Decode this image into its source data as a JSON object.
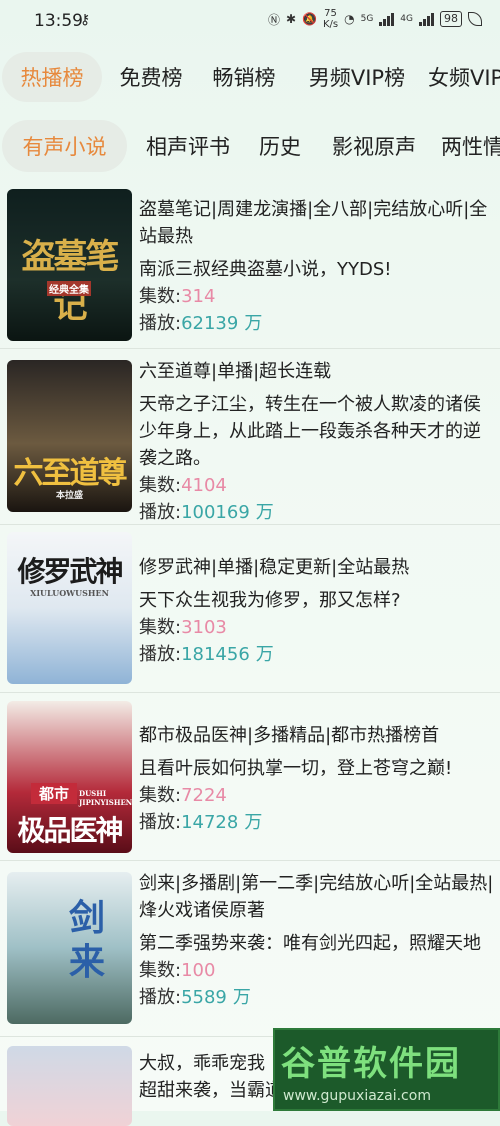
{
  "status": {
    "time": "13:59",
    "speed_value": "75",
    "speed_unit": "K/s",
    "battery": "98",
    "net1": "5G",
    "net2": "4G"
  },
  "top_tabs": [
    {
      "label": "热播榜",
      "active": true
    },
    {
      "label": "免费榜",
      "active": false
    },
    {
      "label": "畅销榜",
      "active": false
    },
    {
      "label": "男频VIP榜",
      "active": false
    },
    {
      "label": "女频VIP",
      "active": false
    }
  ],
  "sub_tabs": [
    {
      "label": "有声小说",
      "active": true
    },
    {
      "label": "相声评书",
      "active": false
    },
    {
      "label": "历史",
      "active": false
    },
    {
      "label": "影视原声",
      "active": false
    },
    {
      "label": "两性情",
      "active": false
    }
  ],
  "labels": {
    "episodes": "集数:",
    "plays": "播放:",
    "wan": "万"
  },
  "books": [
    {
      "cover_title": "盗墓笔记",
      "cover_sub": "经典全集",
      "title": "盗墓笔记|周建龙演播|全八部|完结放心听|全站最热",
      "desc": "南派三叔经典盗墓小说，YYDS!",
      "episodes": "314",
      "plays": "62139"
    },
    {
      "cover_title": "六至道尊",
      "cover_sub": "本拉盛",
      "title": "六至道尊|单播|超长连载",
      "desc": "天帝之子江尘，转生在一个被人欺凌的诸侯少年身上，从此踏上一段轰杀各种天才的逆袭之路。",
      "episodes": "4104",
      "plays": "100169"
    },
    {
      "cover_title": "修罗武神",
      "cover_sub": "XIULUOWUSHEN",
      "title": "修罗武神|单播|稳定更新|全站最热",
      "desc": "天下众生视我为修罗，那又怎样?",
      "episodes": "3103",
      "plays": "181456"
    },
    {
      "cover_title": "极品医神",
      "cover_sub": "都市",
      "cover_pinyin": "DUSHI JIPINYISHEN",
      "title": "都市极品医神|多播精品|都市热播榜首",
      "desc": "且看叶辰如何执掌一切，登上苍穹之巅!",
      "episodes": "7224",
      "plays": "14728"
    },
    {
      "cover_title": "剑来",
      "cover_sub": "剑来",
      "title": "剑来|多播剧|第一二季|完结放心听|全站最热|烽火戏诸侯原著",
      "desc": "第二季强势来袭：唯有剑光四起，照耀天地",
      "episodes": "100",
      "plays": "5589"
    },
    {
      "cover_title": "",
      "title": "大叔，乖乖宠我",
      "desc": "超甜来袭，当霸道"
    }
  ],
  "watermark": {
    "main": "谷普软件园",
    "url": "www.gupuxiazai.com"
  },
  "colors": {
    "accent": "#e7893d",
    "pink": "#e88aa6",
    "teal": "#3aa6a6"
  }
}
